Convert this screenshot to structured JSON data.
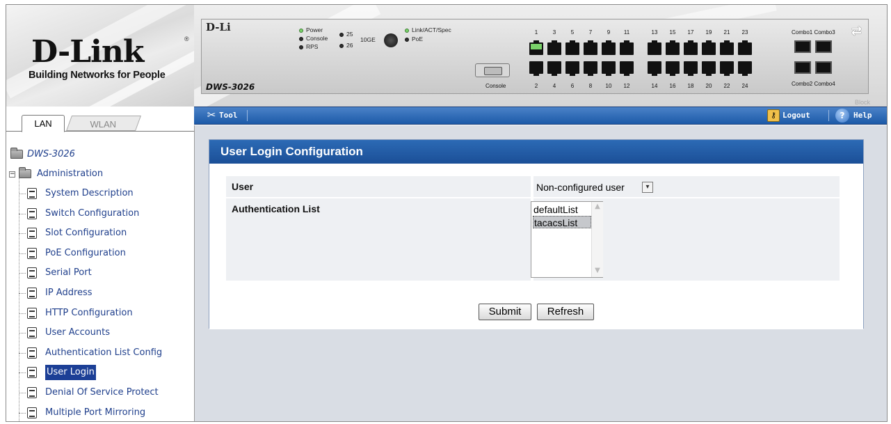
{
  "brand": {
    "name": "D-Link",
    "registered": "®",
    "tagline": "Building Networks for People"
  },
  "nav_tabs": [
    {
      "label": "LAN",
      "active": true
    },
    {
      "label": "WLAN",
      "active": false
    }
  ],
  "tree": {
    "root": "DWS-3026",
    "folder": "Administration",
    "items": [
      {
        "label": "System Description"
      },
      {
        "label": "Switch Configuration"
      },
      {
        "label": "Slot Configuration"
      },
      {
        "label": "PoE Configuration"
      },
      {
        "label": "Serial Port"
      },
      {
        "label": "IP Address"
      },
      {
        "label": "HTTP Configuration"
      },
      {
        "label": "User Accounts"
      },
      {
        "label": "Authentication List Config"
      },
      {
        "label": "User Login",
        "selected": true
      },
      {
        "label": "Denial Of Service Protect"
      },
      {
        "label": "Multiple Port Mirroring"
      }
    ]
  },
  "device": {
    "brand_partial": "D-Li",
    "model": "DWS-3026",
    "led_labels": {
      "power": "Power",
      "console": "Console",
      "rps": "RPS",
      "p25": "25",
      "p26": "26",
      "tenge": "10GE",
      "link": "Link/ACT/Spec",
      "poe": "PoE"
    },
    "console_label": "Console",
    "top_ports": [
      "1",
      "3",
      "5",
      "7",
      "9",
      "11",
      "13",
      "15",
      "17",
      "19",
      "21",
      "23"
    ],
    "bottom_ports": [
      "2",
      "4",
      "6",
      "8",
      "10",
      "12",
      "14",
      "16",
      "18",
      "20",
      "22",
      "24"
    ],
    "combo_top": "Combo1 Combo3",
    "combo_bottom": "Combo2 Combo4",
    "block_label": "Block"
  },
  "toolbar": {
    "tool_label": "Tool",
    "logout_label": "Logout",
    "help_label": "Help"
  },
  "form": {
    "title": "User Login Configuration",
    "user_label": "User",
    "user_value": "Non-configured user",
    "auth_label": "Authentication List",
    "auth_options": [
      "defaultList",
      "tacacsList"
    ],
    "auth_selected": "tacacsList",
    "submit_label": "Submit",
    "refresh_label": "Refresh"
  },
  "colors": {
    "toolbar_blue": "#1c5aa8",
    "title_blue": "#1b4f97",
    "selected_bg": "#1c3f96",
    "link_text": "#1f3f8c",
    "led_green": "#7ad26a"
  }
}
